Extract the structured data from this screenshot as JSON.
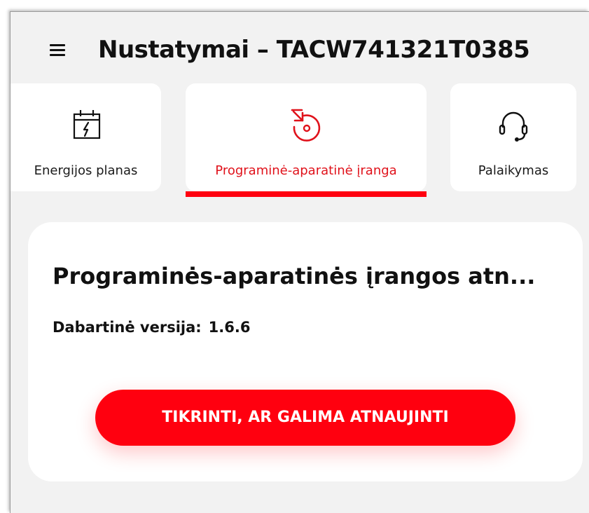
{
  "header": {
    "title": "Nustatymai – TACW741321T0385",
    "menu_icon": "hamburger-menu-icon"
  },
  "tabs": [
    {
      "label": "Energijos planas",
      "icon": "calendar-bolt-icon",
      "selected": false
    },
    {
      "label": "Programinė-aparatinė įranga",
      "icon": "firmware-download-icon",
      "selected": true
    },
    {
      "label": "Palaikymas",
      "icon": "headset-icon",
      "selected": false
    }
  ],
  "card": {
    "title": "Programinės-aparatinės įrangos atn...",
    "version_label": "Dabartinė versija:",
    "version_value": "1.6.6",
    "button_label": "TIKRINTI, AR GALIMA ATNAUJINTI"
  },
  "colors": {
    "accent": "#ff000f",
    "background": "#f2f2f2",
    "surface": "#ffffff",
    "text": "#111111"
  }
}
